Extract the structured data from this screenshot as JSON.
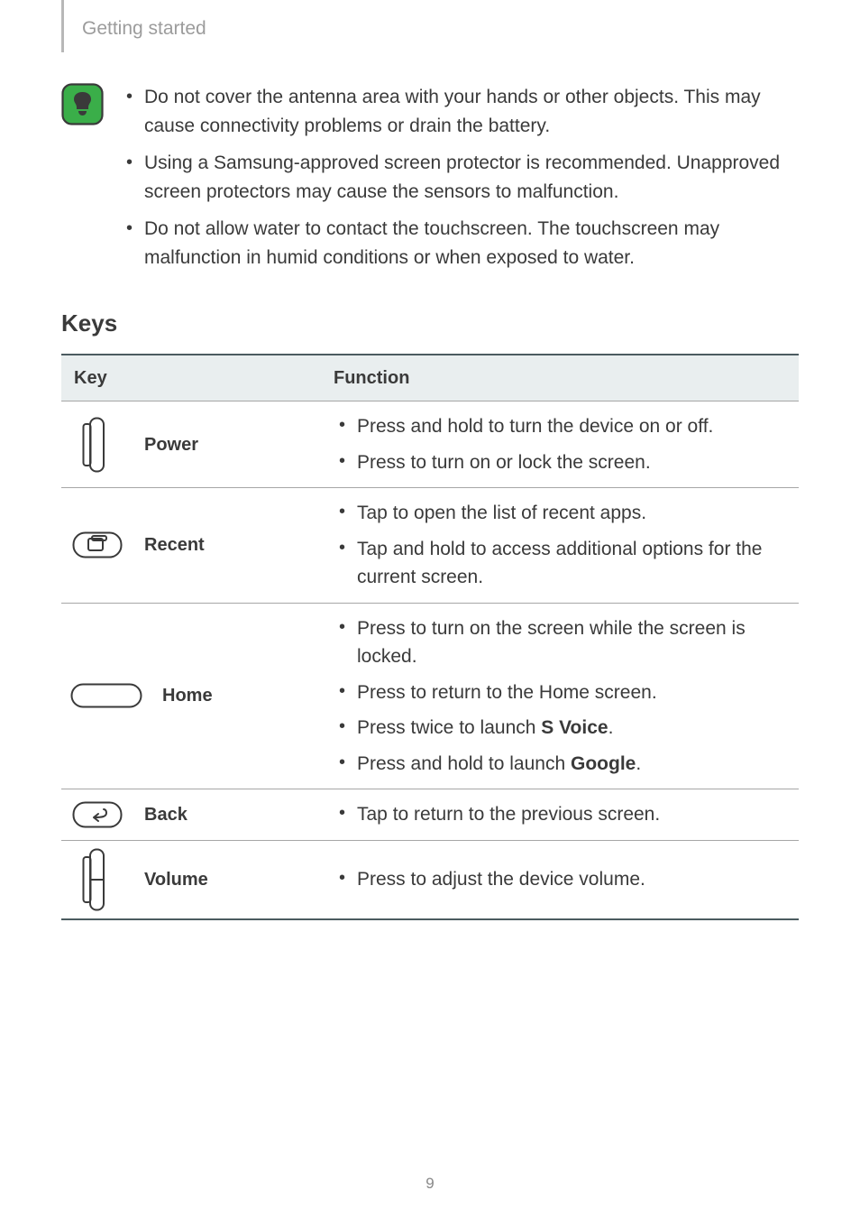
{
  "breadcrumb": "Getting started",
  "notices": [
    "Do not cover the antenna area with your hands or other objects. This may cause connectivity problems or drain the battery.",
    "Using a Samsung-approved screen protector is recommended. Unapproved screen protectors may cause the sensors to malfunction.",
    "Do not allow water to contact the touchscreen. The touchscreen may malfunction in humid conditions or when exposed to water."
  ],
  "keys_heading": "Keys",
  "table": {
    "headers": {
      "key": "Key",
      "function": "Function"
    },
    "rows": [
      {
        "name": "Power",
        "functions": [
          [
            {
              "t": "Press and hold to turn the device on or off."
            }
          ],
          [
            {
              "t": "Press to turn on or lock the screen."
            }
          ]
        ]
      },
      {
        "name": "Recent",
        "functions": [
          [
            {
              "t": "Tap to open the list of recent apps."
            }
          ],
          [
            {
              "t": "Tap and hold to access additional options for the current screen."
            }
          ]
        ]
      },
      {
        "name": "Home",
        "functions": [
          [
            {
              "t": "Press to turn on the screen while the screen is locked."
            }
          ],
          [
            {
              "t": "Press to return to the Home screen."
            }
          ],
          [
            {
              "t": "Press twice to launch "
            },
            {
              "t": "S Voice",
              "b": true
            },
            {
              "t": "."
            }
          ],
          [
            {
              "t": "Press and hold to launch "
            },
            {
              "t": "Google",
              "b": true
            },
            {
              "t": "."
            }
          ]
        ]
      },
      {
        "name": "Back",
        "functions": [
          [
            {
              "t": "Tap to return to the previous screen."
            }
          ]
        ]
      },
      {
        "name": "Volume",
        "functions": [
          [
            {
              "t": "Press to adjust the device volume."
            }
          ]
        ]
      }
    ]
  },
  "page_number": "9"
}
